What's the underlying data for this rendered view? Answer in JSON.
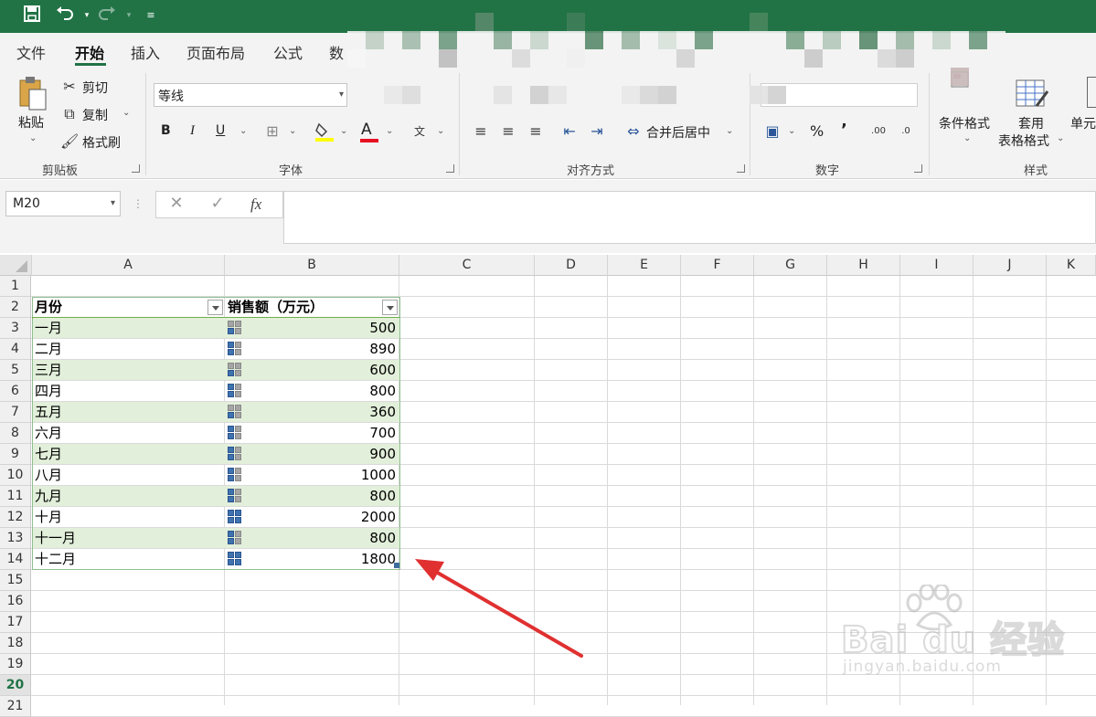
{
  "ribbon": {
    "tabs": [
      "文件",
      "开始",
      "插入",
      "页面布局",
      "公式",
      "数"
    ],
    "clipboard": {
      "paste": "粘贴",
      "cut": "剪切",
      "copy": "复制",
      "format_painter": "格式刷",
      "label": "剪贴板"
    },
    "font": {
      "name": "等线",
      "bold": "B",
      "italic": "I",
      "underline": "U",
      "font_color": "A",
      "label": "字体"
    },
    "alignment": {
      "merge_center": "合并后居中",
      "label": "对齐方式"
    },
    "number": {
      "percent": "%",
      "comma": "’",
      "label": "数字"
    },
    "styles": {
      "conditional": "条件格式",
      "table_format_1": "套用",
      "table_format_2": "表格格式",
      "cell": "单元",
      "label": "样式"
    }
  },
  "formula_bar": {
    "name_box": "M20",
    "fx": "fx",
    "formula": ""
  },
  "columns": [
    "A",
    "B",
    "C",
    "D",
    "E",
    "F",
    "G",
    "H",
    "I",
    "J",
    "K"
  ],
  "rows": [
    "1",
    "2",
    "3",
    "4",
    "5",
    "6",
    "7",
    "8",
    "9",
    "10",
    "11",
    "12",
    "13",
    "14",
    "15",
    "16",
    "17",
    "18",
    "19",
    "20",
    "21"
  ],
  "table": {
    "headers": [
      "月份",
      "销售额（万元）"
    ],
    "rows": [
      {
        "month": "一月",
        "sales": "500",
        "level": 1
      },
      {
        "month": "二月",
        "sales": "890",
        "level": 2
      },
      {
        "month": "三月",
        "sales": "600",
        "level": 1
      },
      {
        "month": "四月",
        "sales": "800",
        "level": 2
      },
      {
        "month": "五月",
        "sales": "360",
        "level": 1
      },
      {
        "month": "六月",
        "sales": "700",
        "level": 2
      },
      {
        "month": "七月",
        "sales": "900",
        "level": 2
      },
      {
        "month": "八月",
        "sales": "1000",
        "level": 2
      },
      {
        "month": "九月",
        "sales": "800",
        "level": 2
      },
      {
        "month": "十月",
        "sales": "2000",
        "level": 4
      },
      {
        "month": "十一月",
        "sales": "800",
        "level": 2
      },
      {
        "month": "十二月",
        "sales": "1800",
        "level": 4
      }
    ]
  },
  "watermark": {
    "brand": "Bai du 经验",
    "url": "jingyan.baidu.com"
  },
  "colors": {
    "excel_green": "#217346",
    "band": "#e2efda",
    "icon_blue": "#3f72af",
    "icon_gray": "#a5a5a5",
    "arrow": "#e03030"
  }
}
